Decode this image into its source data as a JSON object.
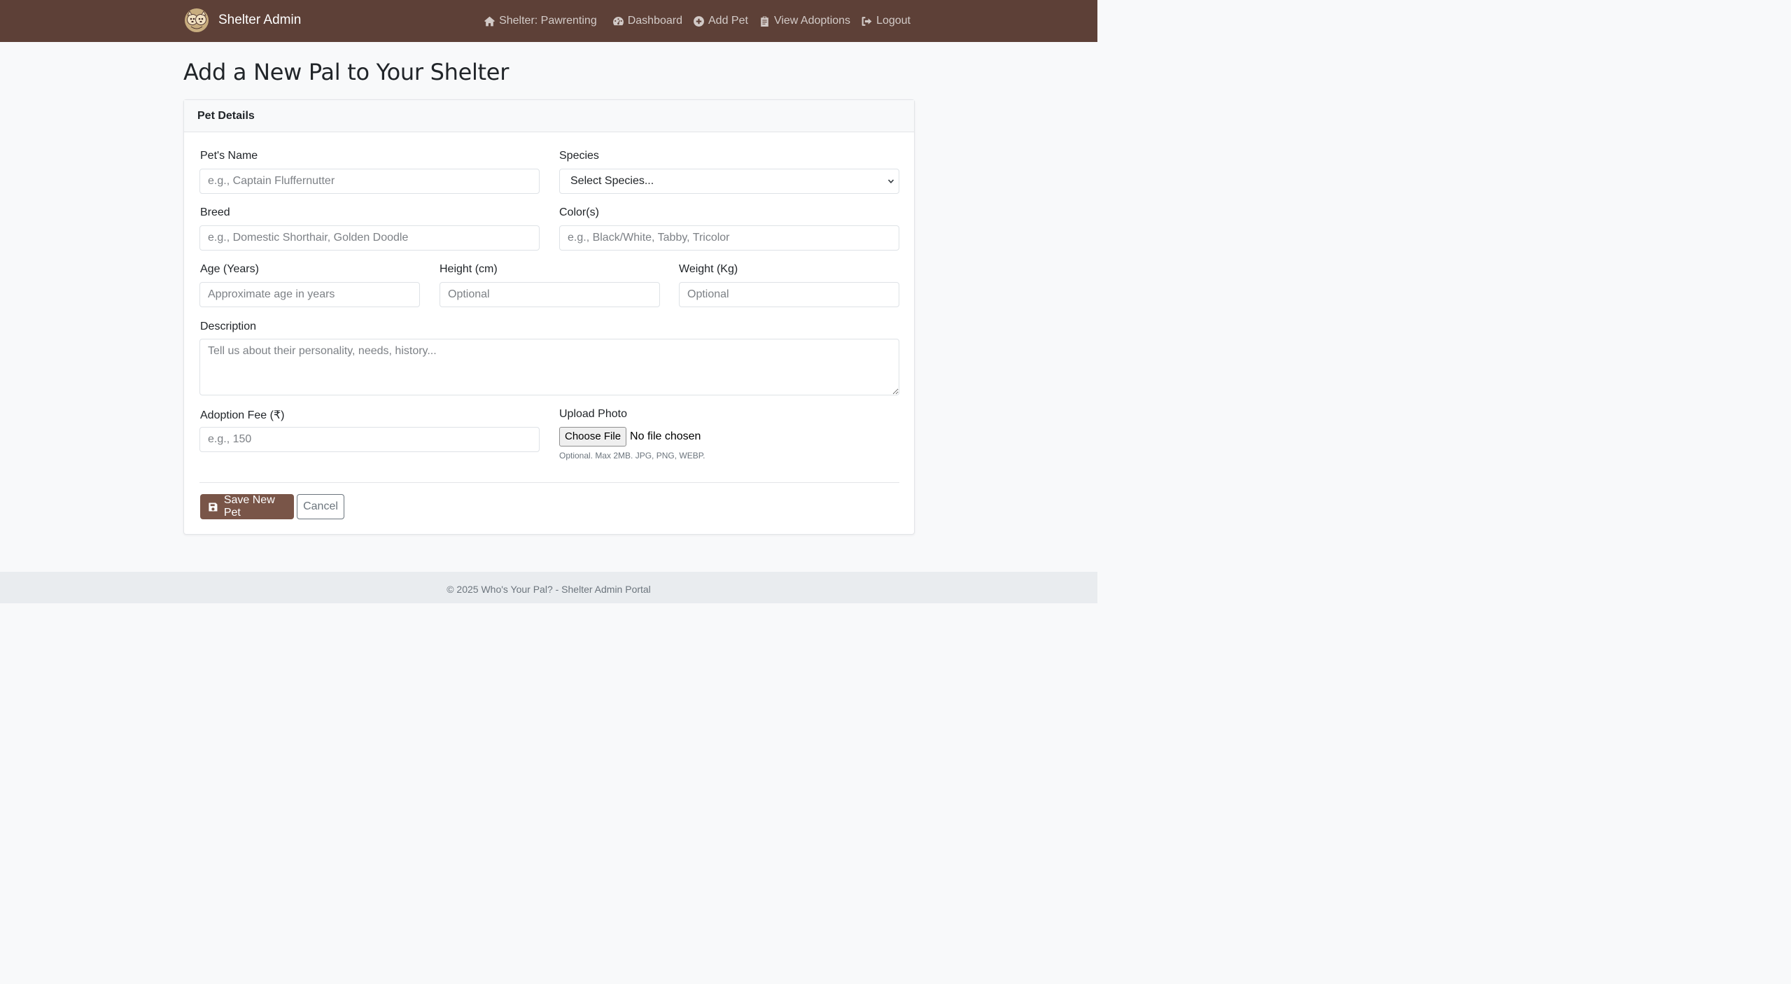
{
  "nav": {
    "brand": "Shelter Admin",
    "logo_icon": "paw-logo-icon",
    "items": [
      {
        "label": "Shelter: Pawrenting",
        "icon": "home-icon"
      },
      {
        "label": "Dashboard",
        "icon": "gauge-icon"
      },
      {
        "label": "Add Pet",
        "icon": "plus-circle-icon"
      },
      {
        "label": "View Adoptions",
        "icon": "clipboard-icon"
      },
      {
        "label": "Logout",
        "icon": "logout-icon"
      }
    ]
  },
  "page": {
    "title": "Add a New Pal to Your Shelter"
  },
  "card": {
    "header": "Pet Details"
  },
  "form": {
    "name": {
      "label": "Pet's Name",
      "placeholder": "e.g., Captain Fluffernutter",
      "value": ""
    },
    "species": {
      "label": "Species",
      "selected": "Select Species..."
    },
    "breed": {
      "label": "Breed",
      "placeholder": "e.g., Domestic Shorthair, Golden Doodle",
      "value": ""
    },
    "color": {
      "label": "Color(s)",
      "placeholder": "e.g., Black/White, Tabby, Tricolor",
      "value": ""
    },
    "age": {
      "label": "Age (Years)",
      "placeholder": "Approximate age in years",
      "value": ""
    },
    "height": {
      "label": "Height (cm)",
      "placeholder": "Optional",
      "value": ""
    },
    "weight": {
      "label": "Weight (Kg)",
      "placeholder": "Optional",
      "value": ""
    },
    "description": {
      "label": "Description",
      "placeholder": "Tell us about their personality, needs, history...",
      "value": ""
    },
    "fee": {
      "label": "Adoption Fee (₹)",
      "placeholder": "e.g., 150",
      "value": ""
    },
    "photo": {
      "label": "Upload Photo",
      "button": "Choose File",
      "status": "No file chosen",
      "help": "Optional. Max 2MB. JPG, PNG, WEBP."
    },
    "save_label": "Save New Pet",
    "save_icon": "save-icon",
    "cancel_label": "Cancel"
  },
  "footer": {
    "text": "© 2025 Who's Your Pal? - Shelter Admin Portal"
  },
  "colors": {
    "navbar": "#5d4037",
    "primary_button": "#795548",
    "page_bg": "#f8f9fa",
    "footer_bg": "#e9ecef"
  }
}
